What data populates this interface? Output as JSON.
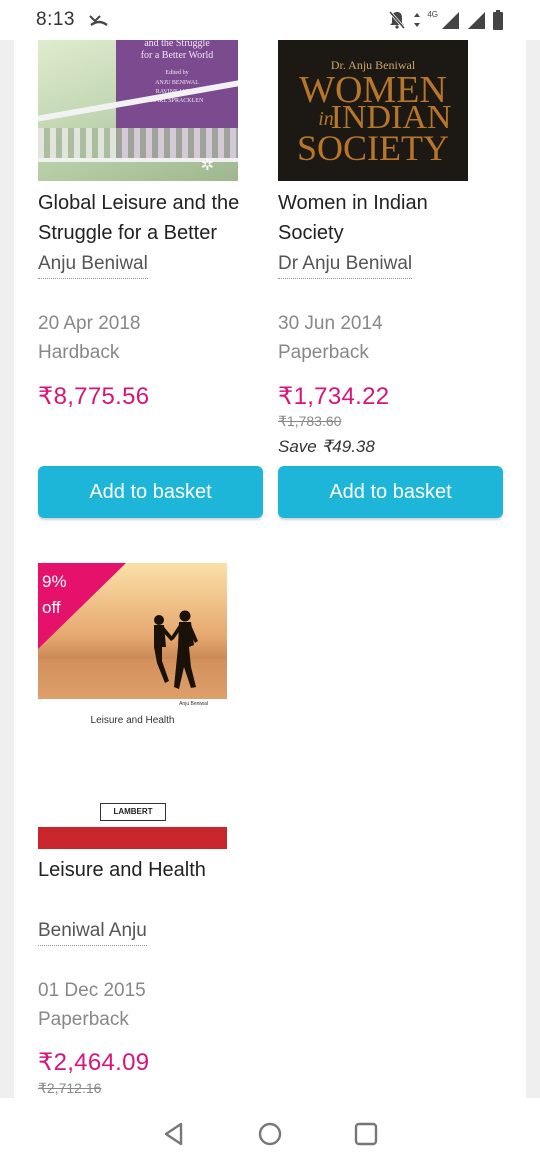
{
  "status_bar": {
    "time": "8:13",
    "network": "4G",
    "icons": [
      "missed-call-icon",
      "mute-bell-icon",
      "data-arrows-icon",
      "signal-icon",
      "signal-icon",
      "battery-icon"
    ]
  },
  "colors": {
    "price": "#d6157a",
    "button": "#1db6d8",
    "badge": "#e6116b"
  },
  "products": [
    {
      "cover_lines": [
        "and the Struggle",
        "for a Better World",
        "Edited by",
        "ANJU BENIWAL",
        "RAVINE JAIN &",
        "KARL SPRACKLEN"
      ],
      "title_line1": "Global Leisure and the",
      "title_line2": "Struggle for a Better",
      "author": "Anju Beniwal",
      "date": "20 Apr 2018",
      "format": "Hardback",
      "price": "₹8,775.56",
      "button": "Add to basket"
    },
    {
      "cover_author": "Dr. Anju Beniwal",
      "cover_title_1": "WOMEN",
      "cover_title_2": "in",
      "cover_title_3": "INDIAN",
      "cover_title_4": "SOCIETY",
      "title_line1": "Women in Indian",
      "title_line2": "Society",
      "author": "Dr Anju Beniwal",
      "date": "30 Jun 2014",
      "format": "Paperback",
      "price": "₹1,734.22",
      "rrp": "₹1,783.60",
      "save": "Save ₹49.38",
      "button": "Add to basket"
    },
    {
      "badge_line1": "9%",
      "badge_line2": "off",
      "cover_author_small": "Anju Beniwal",
      "cover_title": "Leisure and Health",
      "cover_publisher": "LAMBERT",
      "title": "Leisure and Health",
      "author": "Beniwal Anju",
      "date": "01 Dec 2015",
      "format": "Paperback",
      "price": "₹2,464.09",
      "rrp": "₹2,712.16"
    }
  ],
  "nav": {
    "icons": [
      "back-icon",
      "home-icon",
      "recents-icon"
    ]
  }
}
